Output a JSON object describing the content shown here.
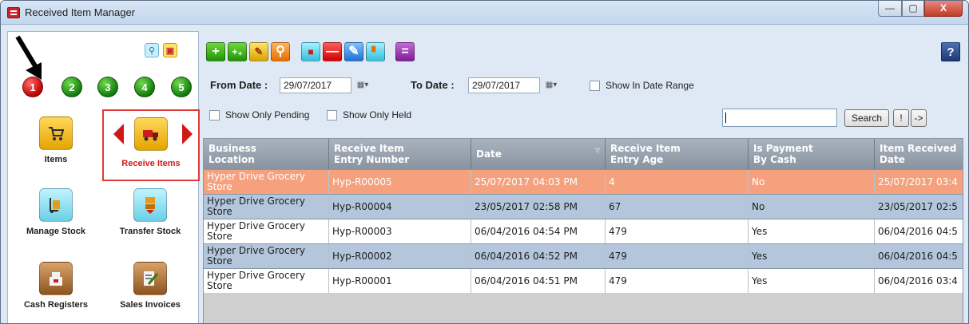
{
  "window": {
    "title": "Received Item Manager",
    "controls": {
      "minimize": "—",
      "maximize": "▢",
      "close": "X"
    }
  },
  "sidebar": {
    "page_numbers": [
      "1",
      "2",
      "3",
      "4",
      "5"
    ],
    "active_page": "1",
    "tiles": [
      {
        "label": "Items",
        "icon": "shopping-cart-icon"
      },
      {
        "label": "Receive Items",
        "icon": "delivery-truck-icon",
        "selected": true
      },
      {
        "label": "Manage Stock",
        "icon": "hand-truck-icon"
      },
      {
        "label": "Transfer Stock",
        "icon": "box-transfer-icon"
      },
      {
        "label": "Cash Registers",
        "icon": "cash-register-icon"
      },
      {
        "label": "Sales Invoices",
        "icon": "invoice-pen-icon"
      }
    ]
  },
  "filters": {
    "from_label": "From Date :",
    "from_value": "29/07/2017",
    "to_label": "To Date :",
    "to_value": "29/07/2017",
    "show_in_range": "Show In Date Range",
    "show_pending": "Show Only Pending",
    "show_held": "Show Only Held",
    "search_button": "Search",
    "bang_button": "!",
    "go_button": "->",
    "search_value": ""
  },
  "toolbar": {
    "help": "?"
  },
  "grid": {
    "columns": [
      {
        "line1": "Business",
        "line2": "Location"
      },
      {
        "line1": "Receive Item",
        "line2": "Entry Number"
      },
      {
        "line1": "Date",
        "line2": ""
      },
      {
        "line1": "Receive Item",
        "line2": "Entry Age"
      },
      {
        "line1": "Is Payment",
        "line2": "By Cash"
      },
      {
        "line1": "Item Received",
        "line2": "Date"
      }
    ],
    "rows": [
      {
        "location": "Hyper Drive Grocery Store",
        "entry": "Hyp-R00005",
        "date": "25/07/2017 04:03 PM",
        "age": "4",
        "cash": "No",
        "received": "25/07/2017 03:4"
      },
      {
        "location": "Hyper Drive Grocery Store",
        "entry": "Hyp-R00004",
        "date": "23/05/2017 02:58 PM",
        "age": "67",
        "cash": "No",
        "received": "23/05/2017 02:5"
      },
      {
        "location": "Hyper Drive Grocery Store",
        "entry": "Hyp-R00003",
        "date": "06/04/2016 04:54 PM",
        "age": "479",
        "cash": "Yes",
        "received": "06/04/2016 04:5"
      },
      {
        "location": "Hyper Drive Grocery Store",
        "entry": "Hyp-R00002",
        "date": "06/04/2016 04:52 PM",
        "age": "479",
        "cash": "Yes",
        "received": "06/04/2016 04:5"
      },
      {
        "location": "Hyper Drive Grocery Store",
        "entry": "Hyp-R00001",
        "date": "06/04/2016 04:51 PM",
        "age": "479",
        "cash": "Yes",
        "received": "06/04/2016 03:4"
      }
    ]
  },
  "colors": {
    "selected_row": "#f5a17d",
    "alt_row": "#b4c6dc",
    "row": "#ffffff",
    "header": "#97a1ad",
    "highlight_border": "#e23a3a"
  }
}
